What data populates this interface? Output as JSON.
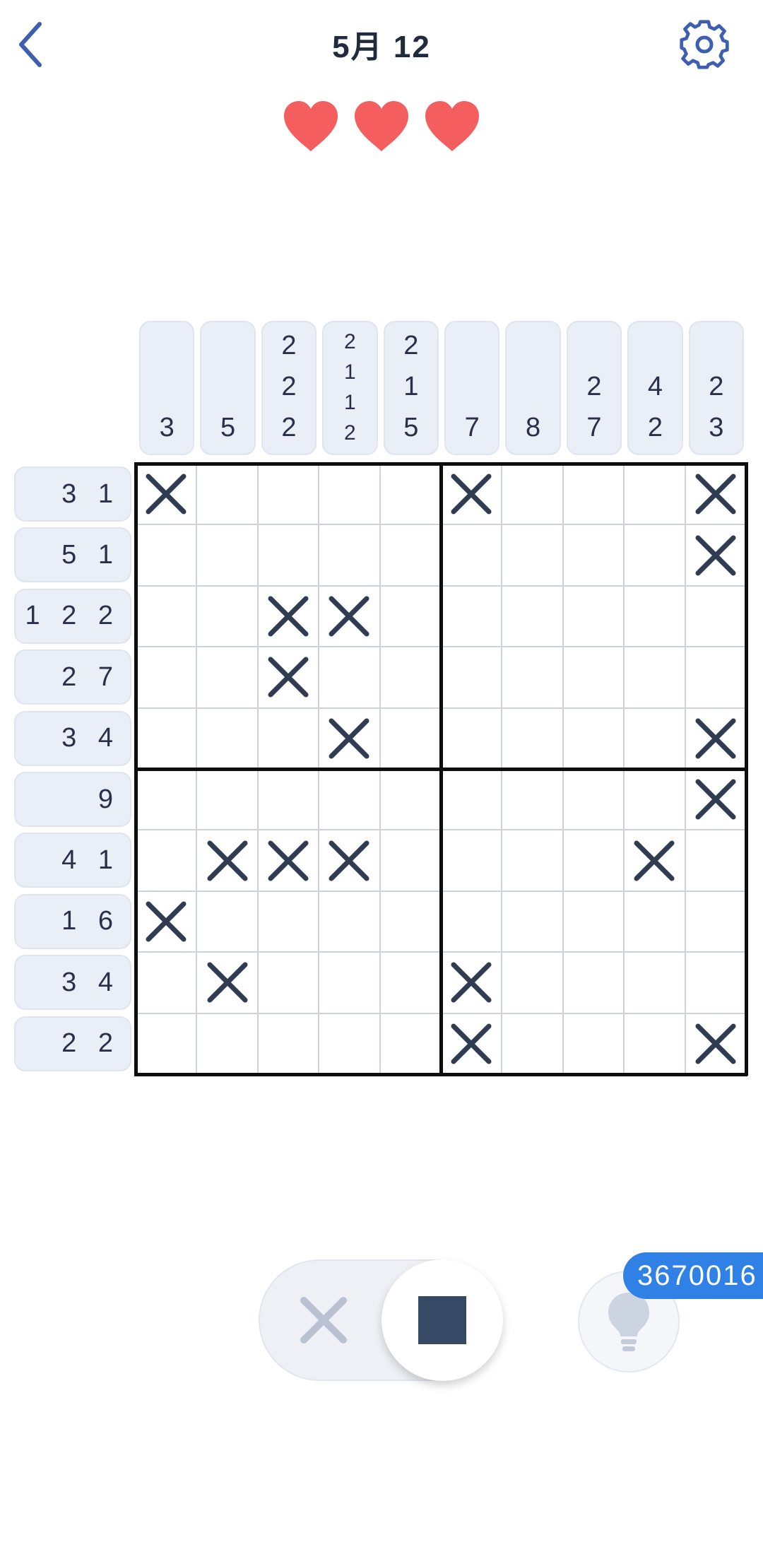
{
  "header": {
    "title": "5月 12",
    "back_icon": "chevron-left-icon",
    "settings_icon": "gear-icon"
  },
  "lives": {
    "hearts": 3,
    "icon": "heart-icon",
    "color": "#f45e5e"
  },
  "puzzle": {
    "size": 10,
    "column_clues": [
      [
        "3"
      ],
      [
        "5"
      ],
      [
        "2",
        "2",
        "2"
      ],
      [
        "2",
        "1",
        "1",
        "2"
      ],
      [
        "2",
        "1",
        "5"
      ],
      [
        "7"
      ],
      [
        "8"
      ],
      [
        "2",
        "7"
      ],
      [
        "4",
        "2"
      ],
      [
        "2",
        "3"
      ]
    ],
    "row_clues": [
      "3 1",
      "5 1",
      "1 2 2",
      "2 7",
      "3 4",
      "9",
      "4 1",
      "1 6",
      "3 4",
      "2 2"
    ],
    "x_marks": [
      [
        0,
        0
      ],
      [
        0,
        5
      ],
      [
        0,
        9
      ],
      [
        1,
        9
      ],
      [
        2,
        2
      ],
      [
        2,
        3
      ],
      [
        3,
        2
      ],
      [
        4,
        3
      ],
      [
        4,
        9
      ],
      [
        5,
        9
      ],
      [
        6,
        1
      ],
      [
        6,
        2
      ],
      [
        6,
        3
      ],
      [
        6,
        8
      ],
      [
        7,
        0
      ],
      [
        8,
        1
      ],
      [
        8,
        5
      ],
      [
        9,
        5
      ],
      [
        9,
        9
      ]
    ]
  },
  "controls": {
    "mode_x_icon": "cross-icon",
    "mode_fill_icon": "filled-square-icon",
    "active_mode": "fill",
    "hint_icon": "lightbulb-icon",
    "hint_count": "3670016"
  },
  "colors": {
    "accent": "#3e5fb0",
    "mark": "#2f3c52",
    "clue_bg": "#eaeef7",
    "badge": "#3081e6"
  }
}
